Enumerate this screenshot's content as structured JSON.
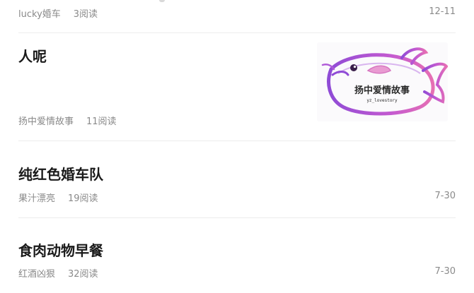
{
  "articles": [
    {
      "author": "lucky婚车",
      "reads": "3阅读",
      "date": "12-11"
    },
    {
      "title": "人呢",
      "author": "扬中爱情故事",
      "reads": "11阅读",
      "thumbnail": {
        "caption": "扬中爱情故事",
        "subcaption": "yz_lovestory"
      }
    },
    {
      "title": "纯红色婚车队",
      "author": "果汁漂亮",
      "reads": "19阅读",
      "date": "7-30"
    },
    {
      "title": "食肉动物早餐",
      "author": "红酒凶狠",
      "reads": "32阅读",
      "date": "7-30"
    }
  ],
  "colors": {
    "title": "#1a1a1a",
    "meta": "#8a8a8a",
    "divider": "#ececec",
    "fish_purple": "#b05ad8",
    "fish_pink": "#e56fb7"
  }
}
